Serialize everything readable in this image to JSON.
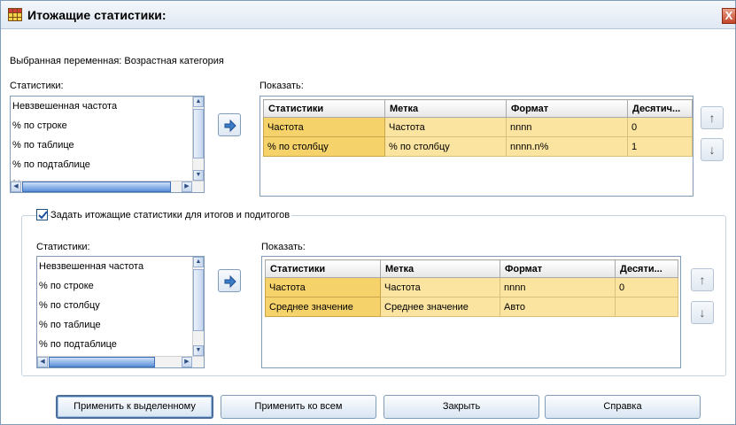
{
  "window": {
    "title": "Итожащие статистики:",
    "close_glyph": "X"
  },
  "selected_variable": "Выбранная переменная: Возрастная категория",
  "top": {
    "stats_label": "Статистики:",
    "stats_items": [
      "Невзвешенная частота",
      "% по строке",
      "% по таблице",
      "% по подтаблице",
      "% по слою"
    ],
    "show_label": "Показать:",
    "columns": [
      "Статистики",
      "Метка",
      "Формат",
      "Десятич..."
    ],
    "rows": [
      [
        "Частота",
        "Частота",
        "nnnn",
        "0"
      ],
      [
        "% по столбцу",
        "% по столбцу",
        "nnnn.n%",
        "1"
      ]
    ]
  },
  "subtotals": {
    "checkbox_label": "Задать итожащие статистики для итогов и подитогов",
    "checked": true,
    "stats_label": "Статистики:",
    "stats_items": [
      "Невзвешенная частота",
      "% по строке",
      "% по столбцу",
      "% по таблице",
      "% по подтаблице"
    ],
    "show_label": "Показать:",
    "columns": [
      "Статистики",
      "Метка",
      "Формат",
      "Десяти..."
    ],
    "rows": [
      [
        "Частота",
        "Частота",
        "nnnn",
        "0"
      ],
      [
        "Среднее значение",
        "Среднее значение",
        "Авто",
        ""
      ]
    ]
  },
  "buttons": {
    "apply_selected": "Применить к выделенному",
    "apply_all": "Применить ко всем",
    "close": "Закрыть",
    "help": "Справка"
  },
  "icons": {
    "move_right": "arrow-right-icon",
    "move_up": "arrow-up-icon",
    "move_down": "arrow-down-icon"
  }
}
